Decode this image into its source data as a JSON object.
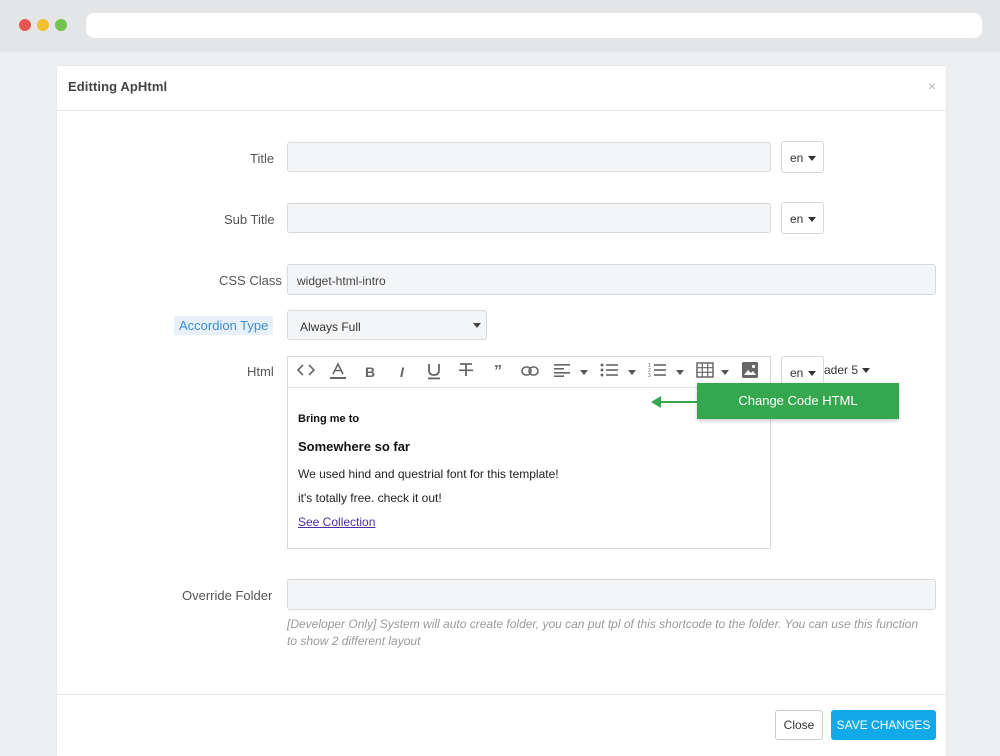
{
  "modal": {
    "title": "Editting ApHtml",
    "close_icon": "×"
  },
  "form": {
    "title_label": "Title",
    "title_value": "",
    "subtitle_label": "Sub Title",
    "subtitle_value": "",
    "lang": "en",
    "css_class_label": "CSS Class",
    "css_class_value": "widget-html-intro",
    "accordion_label": "Accordion Type",
    "accordion_value": "Always Full",
    "html_label": "Html",
    "override_label": "Override Folder",
    "override_value": "",
    "override_help": "[Developer Only] System will auto create folder, you can put tpl of this shortcode to the folder. You can use this function to show 2 different layout"
  },
  "editor": {
    "toolbar_icons": [
      "code-icon",
      "font-color-icon",
      "bold-icon",
      "italic-icon",
      "underline-icon",
      "strikethrough-icon",
      "quote-icon",
      "link-icon",
      "align-icon",
      "bullet-list-icon",
      "numbered-list-icon",
      "table-icon",
      "image-icon"
    ],
    "heading_partial": "ader 5",
    "content": {
      "h1": "Bring me to",
      "h2": "Somewhere so far",
      "p1": "We used hind and questrial font for this template!",
      "p2": "it's totally free. check it out!",
      "link": "See Collection"
    }
  },
  "callout": {
    "label": "Change Code HTML",
    "color": "#35a84f"
  },
  "footer": {
    "close_label": "Close",
    "save_label": "SAVE CHANGES",
    "save_color": "#12a9e8"
  }
}
